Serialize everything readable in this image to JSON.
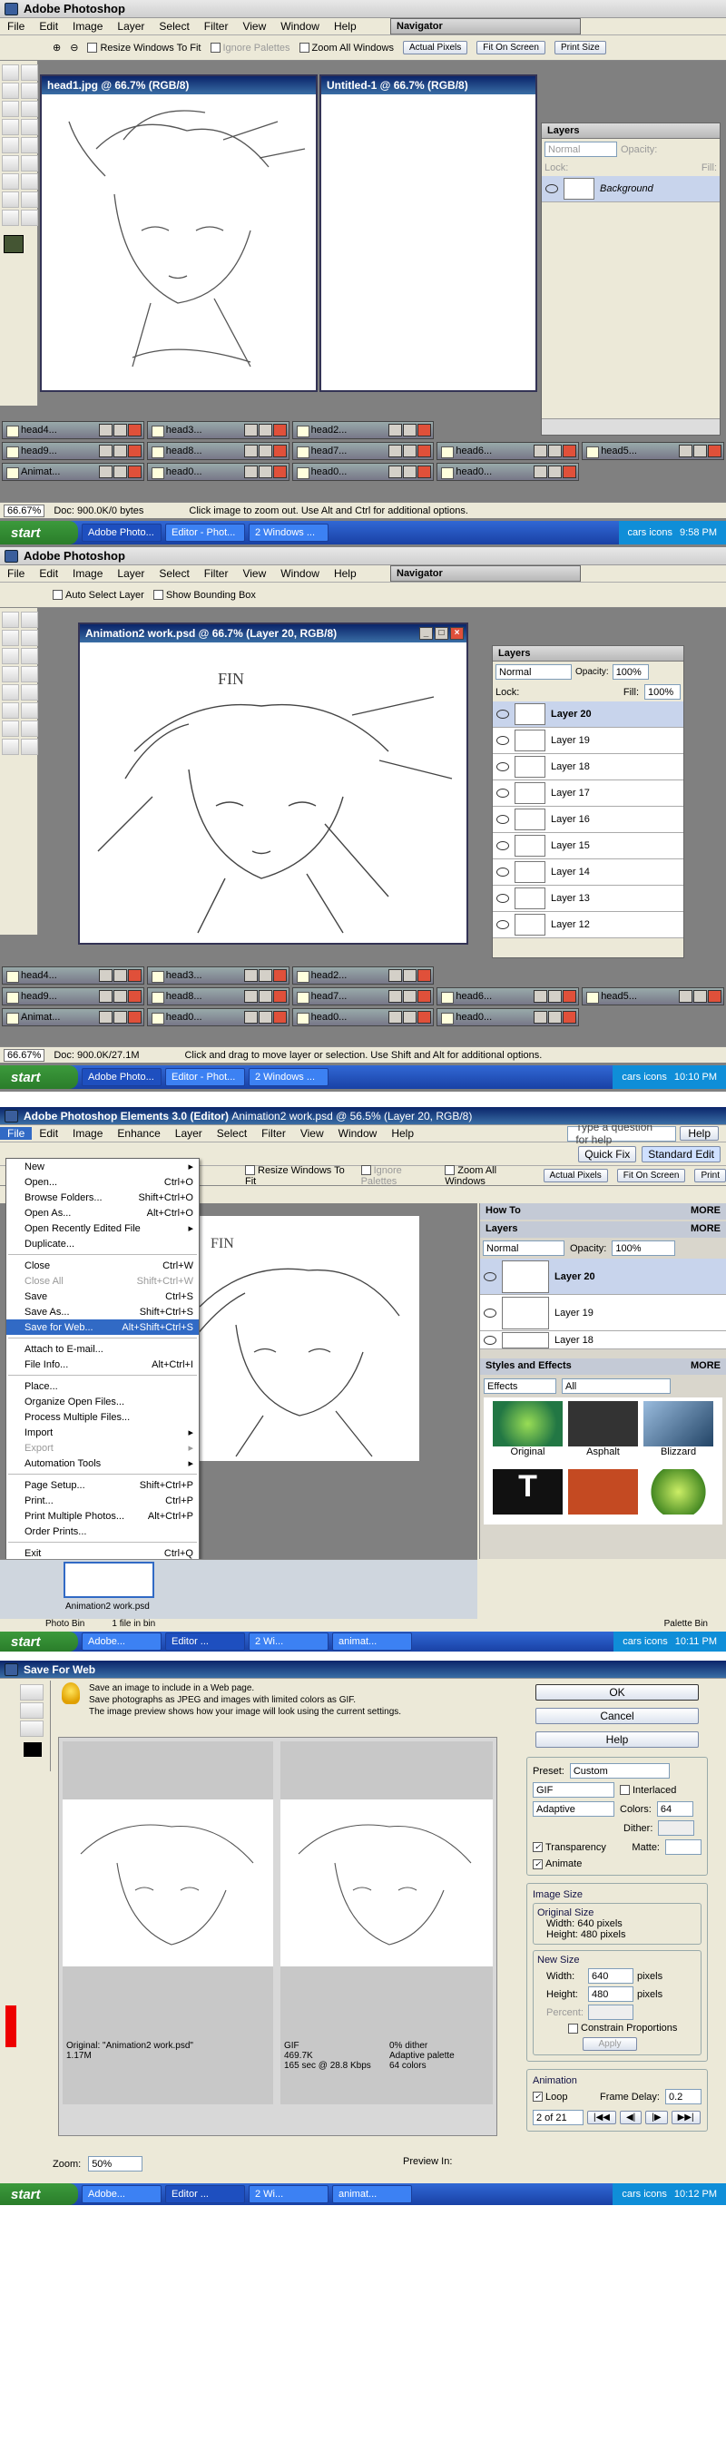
{
  "ps_app_title": "Adobe Photoshop",
  "ps_menu": [
    "File",
    "Edit",
    "Image",
    "Layer",
    "Select",
    "Filter",
    "View",
    "Window",
    "Help"
  ],
  "shot1": {
    "options": {
      "resize": "Resize Windows To Fit",
      "ignore": "Ignore Palettes",
      "zoom_all": "Zoom All Windows",
      "actual": "Actual Pixels",
      "fit": "Fit On Screen",
      "print": "Print Size"
    },
    "navigator_tab": "Navigator",
    "doc1_title": "head1.jpg @ 66.7% (RGB/8)",
    "doc2_title": "Untitled-1 @ 66.7% (RGB/8)",
    "layers_tab": "Layers",
    "blend_mode": "Normal",
    "opacity_label": "Opacity:",
    "lock_label": "Lock:",
    "fill_label": "Fill:",
    "layer_bg": "Background",
    "minimized": [
      "head4...",
      "head3...",
      "head2...",
      "head9...",
      "head8...",
      "head7...",
      "head6...",
      "head5...",
      "Animat...",
      "head0...",
      "head0...",
      "head0..."
    ],
    "status": {
      "zoom": "66.67%",
      "doc": "Doc: 900.0K/0 bytes",
      "hint": "Click image to zoom out. Use Alt and Ctrl for additional options."
    },
    "clock": "9:58 PM"
  },
  "shot2": {
    "options": {
      "auto": "Auto Select Layer",
      "bounding": "Show Bounding Box"
    },
    "navigator_tab": "Navigator",
    "doc_title": "Animation2 work.psd @ 66.7% (Layer 20, RGB/8)",
    "fin_text": "FIN",
    "layers_tab": "Layers",
    "blend_mode": "Normal",
    "opacity": "100%",
    "fill": "100%",
    "layers": [
      "Layer 20",
      "Layer 19",
      "Layer 18",
      "Layer 17",
      "Layer 16",
      "Layer 15",
      "Layer 14",
      "Layer 13",
      "Layer 12"
    ],
    "minimized": [
      "head4...",
      "head3...",
      "head2...",
      "head9...",
      "head8...",
      "head7...",
      "head6...",
      "head5...",
      "Animat...",
      "head0...",
      "head0...",
      "head0..."
    ],
    "status": {
      "zoom": "66.67%",
      "doc": "Doc: 900.0K/27.1M",
      "hint": "Click and drag to move layer or selection. Use Shift and Alt for additional options."
    },
    "clock": "10:10 PM"
  },
  "shot3": {
    "title": "Adobe Photoshop Elements 3.0 (Editor)",
    "title_doc": "Animation2 work.psd @ 56.5% (Layer 20, RGB/8)",
    "menu": [
      "File",
      "Edit",
      "Image",
      "Enhance",
      "Layer",
      "Select",
      "Filter",
      "View",
      "Window",
      "Help"
    ],
    "help_placeholder": "Type a question for help",
    "help_button": "Help",
    "quick_fix": "Quick Fix",
    "standard_edit": "Standard Edit",
    "options": {
      "resize": "Resize Windows To Fit",
      "ignore": "Ignore Palettes",
      "zoom_all": "Zoom All Windows",
      "actual": "Actual Pixels",
      "fit": "Fit On Screen",
      "print": "Print"
    },
    "file_menu": [
      {
        "label": "New",
        "key": "",
        "arrow": true
      },
      {
        "label": "Open...",
        "key": "Ctrl+O"
      },
      {
        "label": "Browse Folders...",
        "key": "Shift+Ctrl+O"
      },
      {
        "label": "Open As...",
        "key": "Alt+Ctrl+O"
      },
      {
        "label": "Open Recently Edited File",
        "key": "",
        "arrow": true
      },
      {
        "label": "Duplicate...",
        "key": ""
      },
      {
        "sep": true
      },
      {
        "label": "Close",
        "key": "Ctrl+W"
      },
      {
        "label": "Close All",
        "key": "Shift+Ctrl+W",
        "dis": true
      },
      {
        "label": "Save",
        "key": "Ctrl+S"
      },
      {
        "label": "Save As...",
        "key": "Shift+Ctrl+S"
      },
      {
        "label": "Save for Web...",
        "key": "Alt+Shift+Ctrl+S",
        "hl": true
      },
      {
        "sep": true
      },
      {
        "label": "Attach to E-mail...",
        "key": ""
      },
      {
        "label": "File Info...",
        "key": "Alt+Ctrl+I"
      },
      {
        "sep": true
      },
      {
        "label": "Place...",
        "key": ""
      },
      {
        "label": "Organize Open Files...",
        "key": ""
      },
      {
        "label": "Process Multiple Files...",
        "key": ""
      },
      {
        "label": "Import",
        "key": "",
        "arrow": true
      },
      {
        "label": "Export",
        "key": "",
        "arrow": true,
        "dis": true
      },
      {
        "label": "Automation Tools",
        "key": "",
        "arrow": true
      },
      {
        "sep": true
      },
      {
        "label": "Page Setup...",
        "key": "Shift+Ctrl+P"
      },
      {
        "label": "Print...",
        "key": "Ctrl+P"
      },
      {
        "label": "Print Multiple Photos...",
        "key": "Alt+Ctrl+P"
      },
      {
        "label": "Order Prints...",
        "key": ""
      },
      {
        "sep": true
      },
      {
        "label": "Exit",
        "key": "Ctrl+Q"
      }
    ],
    "fin_text": "FIN",
    "how_to": "How To",
    "more": "MORE",
    "layers_tab": "Layers",
    "blend_mode": "Normal",
    "opacity_label": "Opacity:",
    "opacity": "100%",
    "layers": [
      "Layer 20",
      "Layer 19",
      "Layer 18"
    ],
    "styles_title": "Styles and Effects",
    "effects_select": "Effects",
    "all_select": "All",
    "effects": [
      "Original",
      "Asphalt",
      "Blizzard",
      "",
      ""
    ],
    "photo_bin": "Photo Bin",
    "bin_count": "1 file in bin",
    "palette_bin": "Palette Bin",
    "bin_thumb_label": "Animation2 work.psd",
    "clock": "10:11 PM"
  },
  "shot4": {
    "title": "Save For Web",
    "info": [
      "Save an image to include in a Web page.",
      "Save photographs as JPEG and images with limited colors as GIF.",
      "The image preview shows how your image will look using the current settings."
    ],
    "ok": "OK",
    "cancel": "Cancel",
    "help": "Help",
    "preset_label": "Preset:",
    "preset": "Custom",
    "format": "GIF",
    "interlaced": "Interlaced",
    "reduction": "Adaptive",
    "colors_label": "Colors:",
    "colors": "64",
    "dither_label": "Dither:",
    "transparency": "Transparency",
    "matte_label": "Matte:",
    "animate": "Animate",
    "image_size": "Image Size",
    "original_size": "Original Size",
    "orig_width": "Width: 640 pixels",
    "orig_height": "Height: 480 pixels",
    "new_size": "New Size",
    "width_label": "Width:",
    "width": "640",
    "height_label": "Height:",
    "height": "480",
    "pixels": "pixels",
    "percent_label": "Percent:",
    "constrain": "Constrain Proportions",
    "apply": "Apply",
    "animation": "Animation",
    "loop": "Loop",
    "frame_delay_label": "Frame Delay:",
    "frame_delay": "0.2",
    "frame_counter": "2 of 21",
    "left_caption": [
      "Original: \"Animation2 work.psd\"",
      "1.17M"
    ],
    "right_caption_l": [
      "GIF",
      "469.7K",
      "165 sec @ 28.8 Kbps"
    ],
    "right_caption_r": [
      "0% dither",
      "Adaptive palette",
      "64 colors"
    ],
    "zoom_label": "Zoom:",
    "zoom": "50%",
    "preview_in": "Preview In:",
    "clock": "10:12 PM"
  },
  "taskbar": {
    "start": "start",
    "ps_items": [
      "Adobe Photo...",
      "Editor - Phot...",
      "2 Windows ..."
    ],
    "pse_items": [
      "Adobe...",
      "Editor ...",
      "2 Wi...",
      "animat..."
    ],
    "tray_text": "cars icons"
  }
}
